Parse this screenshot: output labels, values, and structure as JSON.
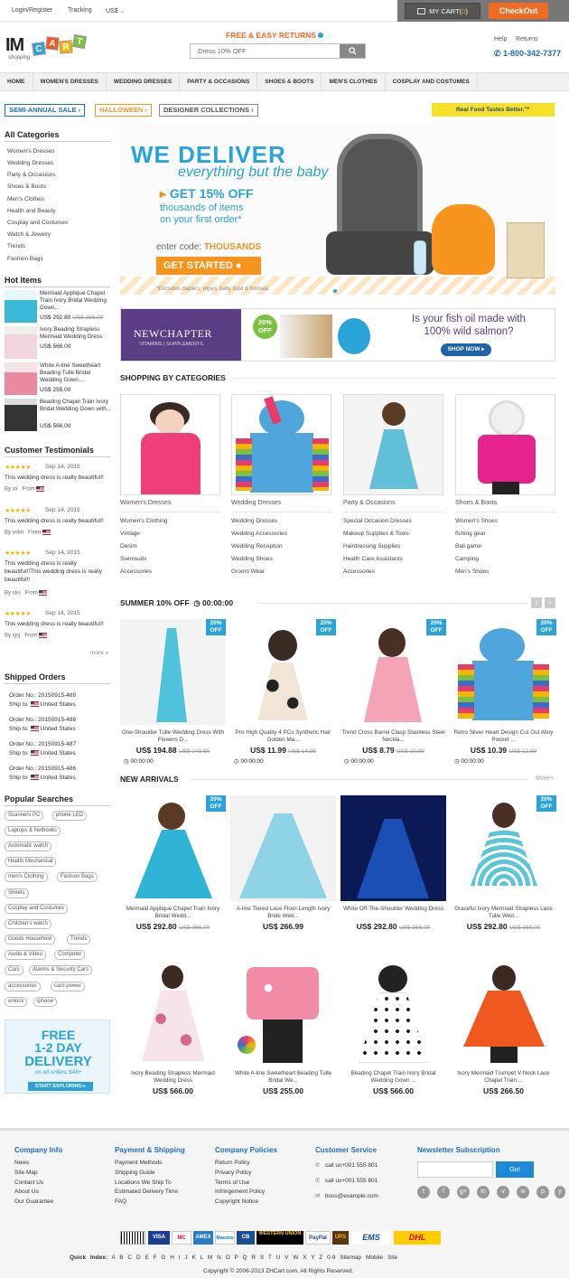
{
  "topbar": {
    "login": "Login/Register",
    "tracking": "Tracking",
    "currency": "US$",
    "mycart": "MY CART(",
    "cart_count": "0",
    "cart_close": ")",
    "checkout": "CheckOut"
  },
  "header": {
    "logo_text": "IM",
    "logo_letters": [
      "C",
      "A",
      "R",
      "T"
    ],
    "logo_sub": "shopping",
    "free_returns": "FREE & EASY RETURNS",
    "search_value": "Dress 10% OFF",
    "help": "Help",
    "returns": "Returns",
    "phone": "1-800-342-7377"
  },
  "nav": [
    "HOME",
    "WOMEN'S DRESSES",
    "WEDDING DRESSES",
    "PARTY & OCCASIONS",
    "SHOES & BOOTS",
    "MEN'S CLOTHES",
    "COSPLAY AND COSTUMES"
  ],
  "promos": {
    "semi": "SEMI-ANNUAL SALE",
    "halloween": "HALLOWEEN",
    "designer": "DESIGNER COLLECTIONS",
    "amber": "Real Food Tastes Better.™"
  },
  "sidebar": {
    "all_categories": "All Categories",
    "categories": [
      "Women's Dresses",
      "Wedding Dresses",
      "Party & Occasions",
      "Shoes & Boots",
      "Men's Clothes",
      "Health and Beauty",
      "Cosplay and Costumes",
      "Watch & Jewelry",
      "Trends",
      "Fashion Bags"
    ],
    "hot_items_title": "Hot Items",
    "hot_items": [
      {
        "title": "Mermaid Applique Chapel Train Ivory Bridal Wedding Gown...",
        "price": "US$ 292.80",
        "old": "US$ 366.00"
      },
      {
        "title": "Ivory Beading Strapless Mermaid Wedding Dress",
        "price": "US$ 566.00",
        "old": ""
      },
      {
        "title": "White A-line Sweetheart Beading Tulle Bridal Wedding Gown...",
        "price": "US$ 255.00",
        "old": ""
      },
      {
        "title": "Beading Chapel Train Ivory Bridal Wedding Gown with...",
        "price": "US$ 566.00",
        "old": ""
      }
    ],
    "testimonials_title": "Customer Testimonials",
    "testimonials": [
      {
        "stars": "★★★★★",
        "date": "Sep 14, 2015",
        "msg": "This wedding dress is really beautiful!!",
        "by": "By",
        "name": "xx",
        "from": "From"
      },
      {
        "stars": "★★★★★",
        "date": "Sep 14, 2015",
        "msg": "This wedding dress is really beautiful!!",
        "by": "By",
        "name": "xskn",
        "from": "From"
      },
      {
        "stars": "★★★★★",
        "date": "Sep 14, 2015",
        "msg": "This wedding dress is really beautiful!!This wedding dress is really beautiful!!",
        "by": "By",
        "name": "xks",
        "from": "From"
      },
      {
        "stars": "★★★★★",
        "date": "Sep 14, 2015",
        "msg": "This wedding dress is really beautiful!!",
        "by": "By",
        "name": "xjsj",
        "from": "From"
      }
    ],
    "more": "more »",
    "shipped_title": "Shipped Orders",
    "orders": [
      {
        "no_label": "Order No.:",
        "no": "20150915-489",
        "ship_label": "Ship to:",
        "country": "United States"
      },
      {
        "no_label": "Order No.:",
        "no": "20150915-488",
        "ship_label": "Ship to:",
        "country": "United States"
      },
      {
        "no_label": "Order No.:",
        "no": "20150915-487",
        "ship_label": "Ship to:",
        "country": "United States"
      },
      {
        "no_label": "Order No.:",
        "no": "20150915-486",
        "ship_label": "Ship to:",
        "country": "United States"
      }
    ],
    "popular_title": "Popular Searches",
    "tags": [
      "Scanners PC",
      "phone LED",
      "Laptops & Netbooks",
      "Automatic watch",
      "Health Mechanical",
      "men's Clothing",
      "Fashion Bags",
      "Sheets",
      "Cosplay and Costumes",
      "Children's watch",
      "Goods Household",
      "Trends",
      "Audio & Video",
      "Computer",
      "Cars",
      "Alarms & Security Cars",
      "accessories",
      "card power",
      "unlock",
      "iphone"
    ],
    "free_delivery": {
      "l1": "FREE",
      "l2": "1-2 DAY",
      "l3": "DELIVERY",
      "l4": "on all orders $49+",
      "btn": "START EXPLORING ▸"
    }
  },
  "banner": {
    "t1": "WE DELIVER",
    "t2": "everything but the baby",
    "t3": "GET 15% OFF",
    "t4a": "thousands of items",
    "t4b": "on your first order*",
    "t5": "enter code:",
    "code": "THOUSANDS",
    "cta": "GET STARTED",
    "note": "*Excludes diapers, wipes, baby food & formula."
  },
  "ad2": {
    "brand": "NEWCHAPTER",
    "brand_sub": "VITAMINS | SUPPLEMENTS",
    "off": "20%",
    "off2": "OFF",
    "q1": "Is your fish oil made with",
    "q2": "100% wild salmon?",
    "shop": "SHOP NOW ▸"
  },
  "categories_section": {
    "title": "SHOPPING BY CATEGORIES",
    "cols": [
      {
        "title": "Women's Dresses",
        "subs": [
          "Women's Clothing",
          "Vintage",
          "Denim",
          "Swimsuits",
          "Accessories"
        ]
      },
      {
        "title": "Wedding Dresses",
        "subs": [
          "Wedding Dresses",
          "Wedding Accessories",
          "Wedding Reception",
          "Wedding Shoes",
          "Groom Wear"
        ]
      },
      {
        "title": "Party & Occasions",
        "subs": [
          "Special Occasion Dresses",
          "Makeup Supplies & Tools",
          "Hairdressing Supplies",
          "Health Care Assistants",
          "Accessories"
        ]
      },
      {
        "title": "Shoes & Boots",
        "subs": [
          "Women's Shoes",
          "fishing gear",
          "Ball game",
          "Camping",
          "Men's Shoes"
        ]
      }
    ]
  },
  "summer": {
    "title": "SUMMER 10% OFF",
    "timer": "00:00:00",
    "prev": "‹",
    "next": "›",
    "items": [
      {
        "badge1": "20%",
        "badge2": "OFF",
        "name": "One-Shoulder Tulle Wedding Dress With Flowers D...",
        "price": "US$ 194.88",
        "old": "US$ 243.60",
        "timer": "00:00:00"
      },
      {
        "badge1": "20%",
        "badge2": "OFF",
        "name": "Pro High Quality 4 PCs Synthetic Hair Golden Ma...",
        "price": "US$ 11.99",
        "old": "US$ 14.99",
        "timer": "00:00:00"
      },
      {
        "badge1": "20%",
        "badge2": "OFF",
        "name": "Trend Cross Barrel Clasp Stainless Steel Neckla...",
        "price": "US$ 8.79",
        "old": "US$ 10.99",
        "timer": "00:00:00"
      },
      {
        "badge1": "20%",
        "badge2": "OFF",
        "name": "Retro Silver Heart Design Cut Out Alloy Pocket ...",
        "price": "US$ 10.39",
        "old": "US$ 12.99",
        "timer": "00:00:00"
      }
    ]
  },
  "new_arrivals": {
    "title": "NEW ARRIVALS",
    "more": "More+",
    "items": [
      {
        "badge": true,
        "badge1": "20%",
        "badge2": "OFF",
        "name": "Mermaid Applique Chapel Train Ivory Bridal Wedd...",
        "price": "US$ 292.80",
        "old": "US$ 366.00"
      },
      {
        "badge": false,
        "name": "A-line Tiered Lace Floor-Length Ivory Bride Wed...",
        "price": "US$ 266.99",
        "old": ""
      },
      {
        "badge": false,
        "name": "White Off-The-Shoulder Wedding Dress",
        "price": "US$ 292.80",
        "old": "US$ 366.00"
      },
      {
        "badge": true,
        "badge1": "20%",
        "badge2": "OFF",
        "name": "Graceful Ivory Mermaid Strapless Lace Tulle Wed...",
        "price": "US$ 292.80",
        "old": "US$ 366.00"
      },
      {
        "badge": false,
        "name": "Ivory Beading Strapless Mermaid Wedding Dress",
        "price": "US$ 566.00",
        "old": ""
      },
      {
        "badge": false,
        "name": "White A-line Sweetheart Beading Tulle Bridal We...",
        "price": "US$ 255.00",
        "old": ""
      },
      {
        "badge": false,
        "name": "Beading Chapel Train Ivory Bridal Wedding Gown ...",
        "price": "US$ 566.00",
        "old": ""
      },
      {
        "badge": false,
        "name": "Ivory Mermaid Trumpet V-Neck Lace Chapel Train ...",
        "price": "US$ 266.50",
        "old": ""
      }
    ]
  },
  "footer": {
    "company_info": {
      "title": "Company Info",
      "links": [
        "News",
        "Site Map",
        "Contact Us",
        "About Us",
        "Our Guarantee"
      ]
    },
    "payment": {
      "title": "Payment & Shipping",
      "links": [
        "Payment Methods",
        "Shipping Guide",
        "Locations We Ship To",
        "Estimated Delivery Time",
        "FAQ"
      ]
    },
    "policies": {
      "title": "Company Policies",
      "links": [
        "Return Policy",
        "Privacy Policy",
        "Terms of Use",
        "Infringement Policy",
        "Copyright Notice"
      ]
    },
    "service": {
      "title": "Customer Service",
      "phone1": "call us+001 555 801",
      "phone2": "call us+001 555 801",
      "email": "boss@example.com"
    },
    "newsletter": {
      "title": "Newsletter Subscription",
      "go": "Go!"
    },
    "social": [
      "t",
      "f",
      "g+",
      "in",
      "v",
      "w",
      "p",
      "y"
    ],
    "payments": [
      "VISA",
      "MC",
      "AMEX",
      "Maestro",
      "CB",
      "WESTERN UNION",
      "PayPal",
      "UPS",
      "EMS",
      "DHL"
    ],
    "quick_index_label": "Quick Index:",
    "quick_index": [
      "A",
      "B",
      "C",
      "D",
      "E",
      "F",
      "G",
      "H",
      "I",
      "J",
      "K",
      "L",
      "M",
      "N",
      "O",
      "P",
      "Q",
      "R",
      "S",
      "T",
      "U",
      "V",
      "W",
      "X",
      "Y",
      "Z",
      "0-9"
    ],
    "sitemap": "Sitemap",
    "mobile": "Mobile Site",
    "copyright": "Copyright © 2006-2013 ZHCart.com. All Rights Reserved."
  }
}
